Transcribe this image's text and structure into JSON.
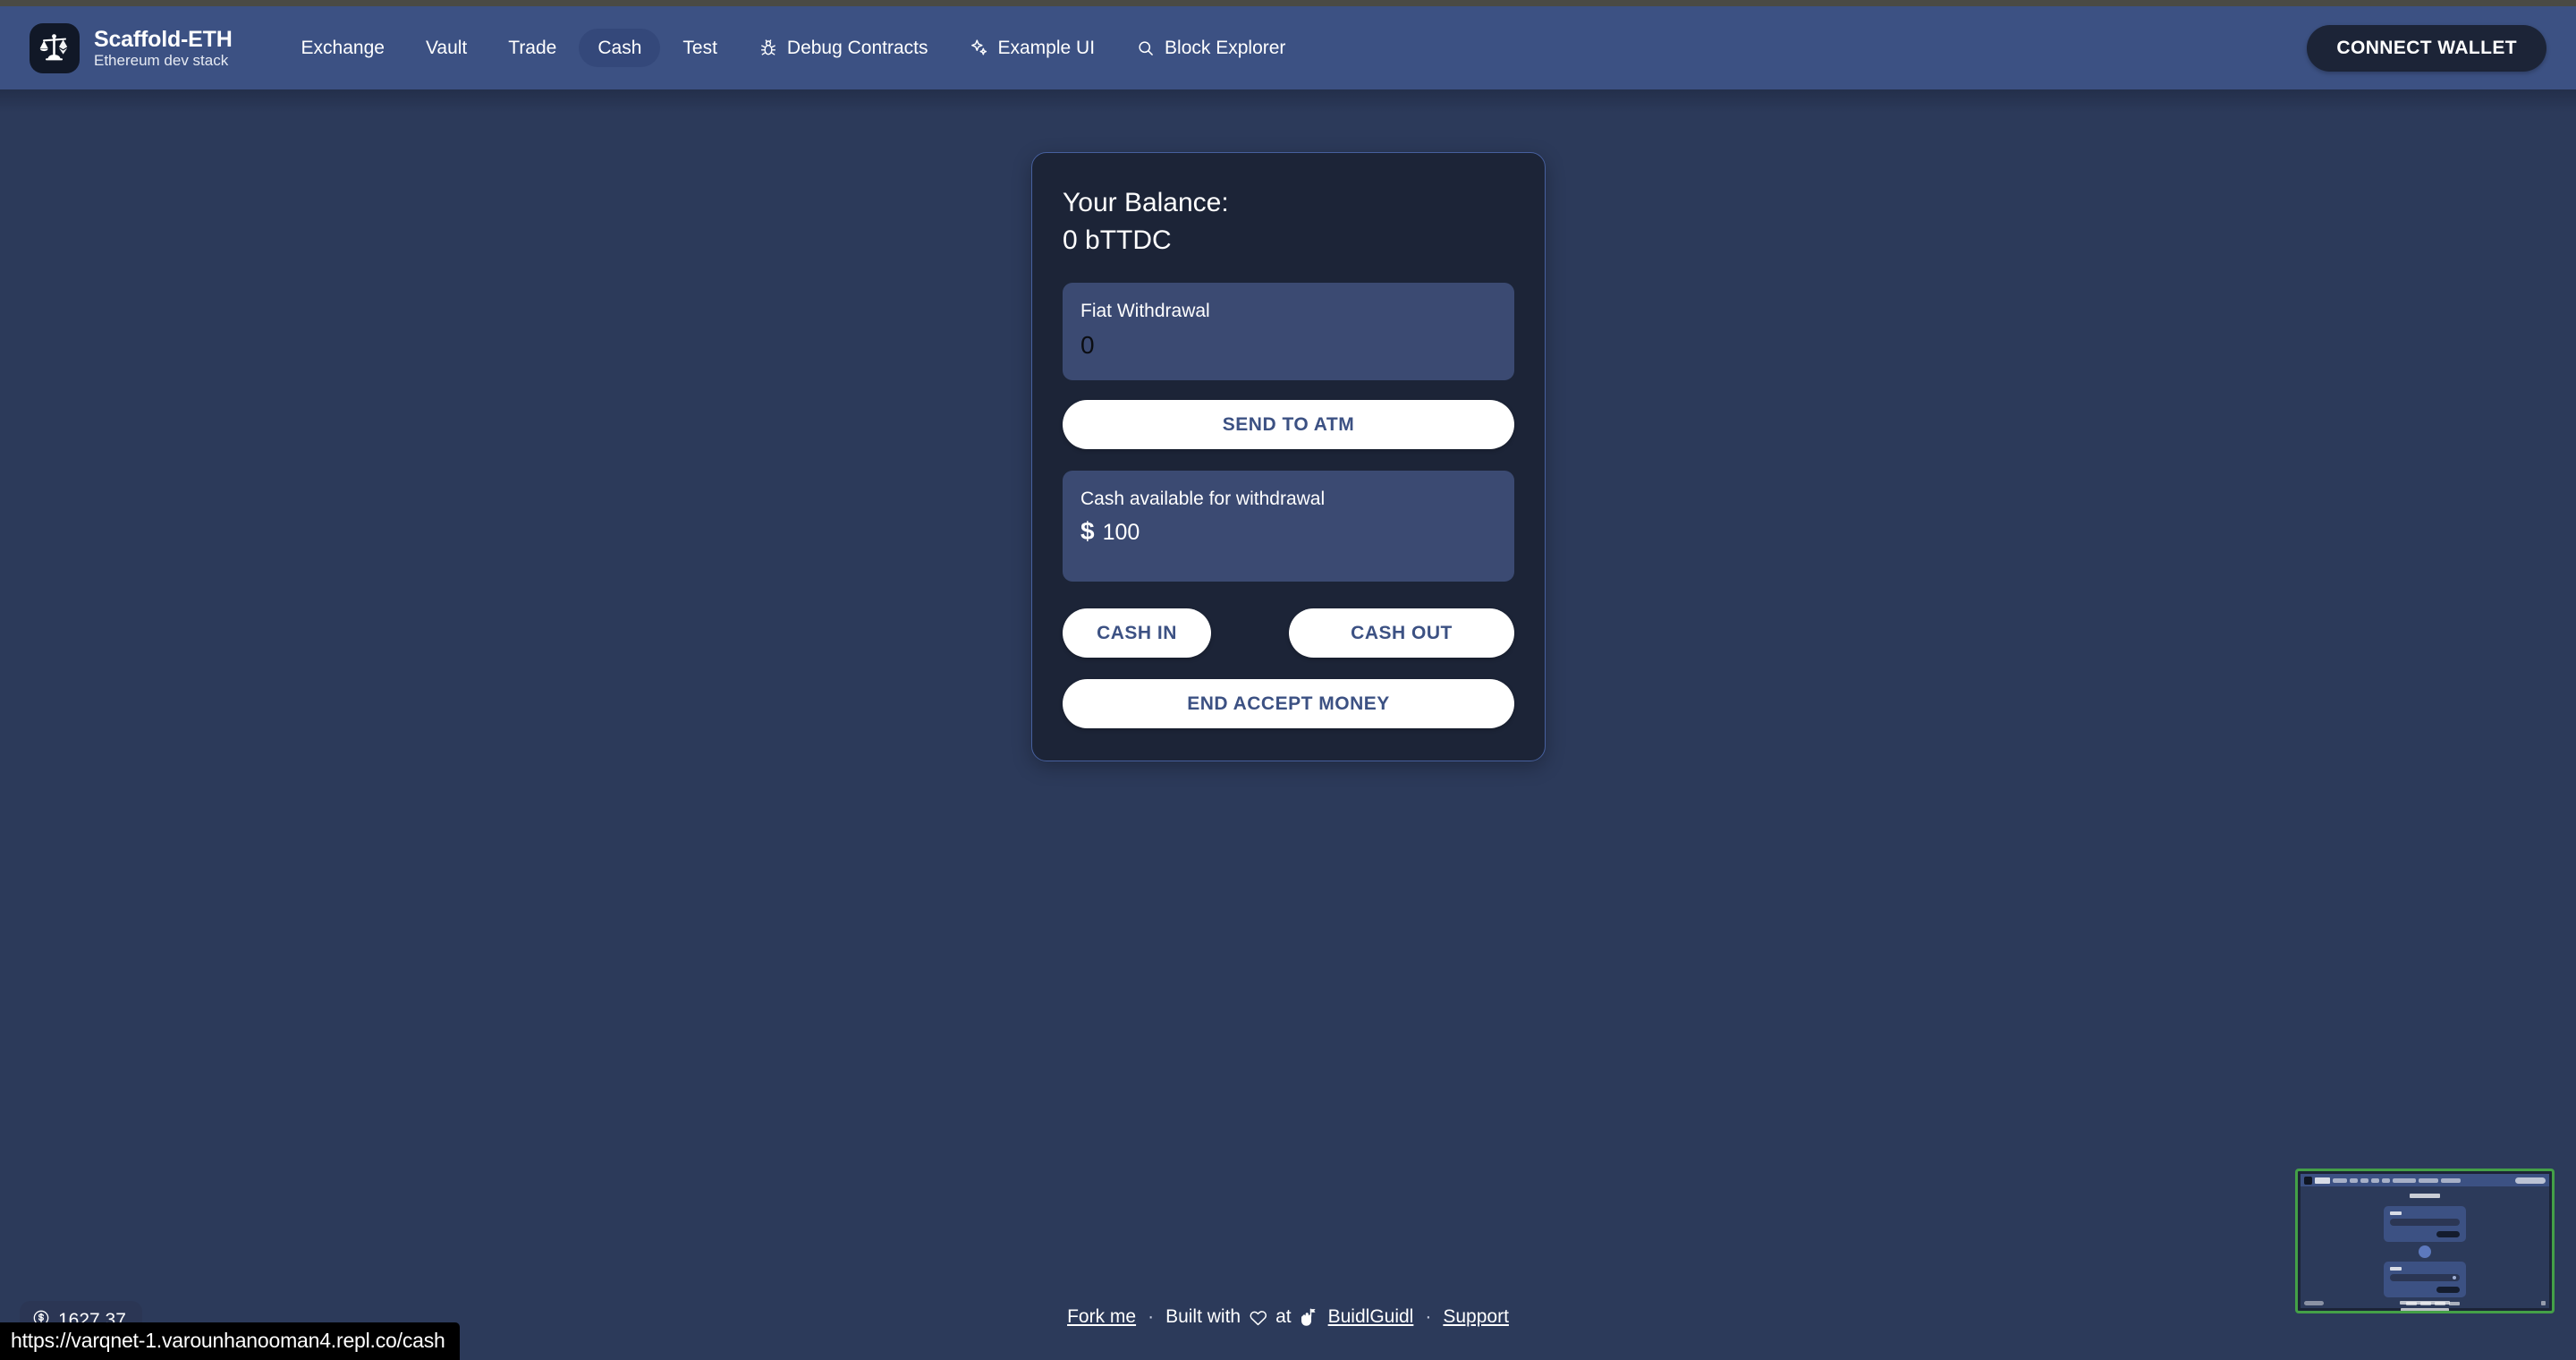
{
  "browser": {
    "status_url": "https://varqnet-1.varounhanooman4.repl.co/cash"
  },
  "header": {
    "brand": {
      "title": "Scaffold-ETH",
      "subtitle": "Ethereum dev stack",
      "logo_icon": "scale-ethereum-logo-icon"
    },
    "nav": [
      {
        "label": "Exchange",
        "icon": null,
        "active": false
      },
      {
        "label": "Vault",
        "icon": null,
        "active": false
      },
      {
        "label": "Trade",
        "icon": null,
        "active": false
      },
      {
        "label": "Cash",
        "icon": null,
        "active": true
      },
      {
        "label": "Test",
        "icon": null,
        "active": false
      },
      {
        "label": "Debug Contracts",
        "icon": "bug-icon",
        "active": false
      },
      {
        "label": "Example UI",
        "icon": "sparkles-icon",
        "active": false
      },
      {
        "label": "Block Explorer",
        "icon": "search-icon",
        "active": false
      }
    ],
    "connect_wallet_label": "CONNECT WALLET"
  },
  "card": {
    "balance_label": "Your Balance:",
    "balance_value": "0 bTTDC",
    "fiat_withdrawal": {
      "label": "Fiat Withdrawal",
      "value": "0",
      "placeholder": "0"
    },
    "send_to_atm_label": "SEND TO ATM",
    "cash_available": {
      "label": "Cash available for withdrawal",
      "currency": "$",
      "amount": "100"
    },
    "cash_in_label": "CASH IN",
    "cash_out_label": "CASH OUT",
    "end_accept_money_label": "END ACCEPT MONEY"
  },
  "footer": {
    "fork_me": "Fork me",
    "dot1": "·",
    "built_with": "Built with",
    "heart_icon": "heart-icon",
    "at": "at",
    "builder_icon": "buidlguidl-hand-icon",
    "buidlguidl": "BuidlGuidl",
    "dot2": "·",
    "support": "Support"
  },
  "price_pill": {
    "icon": "dollar-circle-icon",
    "value": "1627.37"
  },
  "thumbnail": {
    "name": "page-preview-thumbnail",
    "page_title": "EXCHANGE",
    "border_color": "#44a047"
  },
  "colors": {
    "page_background": "#2c3a5a",
    "header_background": "#3c5183",
    "card_background": "#1c2437",
    "card_border": "#47609e",
    "field_background": "#3b4a72",
    "button_background": "#ffffff",
    "button_text": "#3c5183",
    "accent_dark": "#1c2437"
  }
}
